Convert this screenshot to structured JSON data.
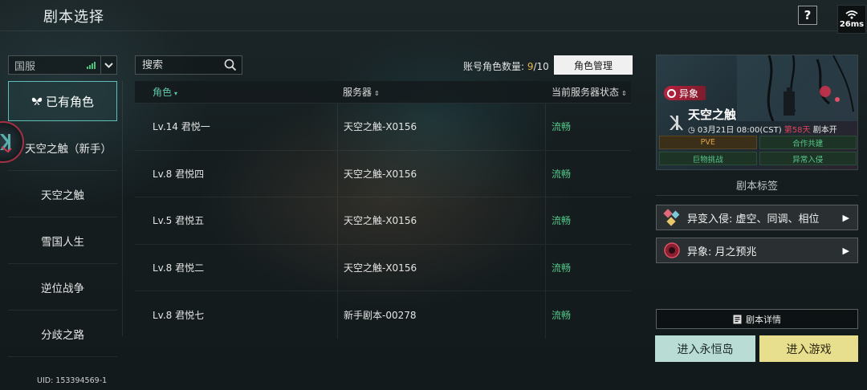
{
  "header": {
    "title": "剧本选择",
    "help_label": "?",
    "ping": "26ms"
  },
  "region": {
    "selected": "国服"
  },
  "sidebar": {
    "items": [
      {
        "label": "已有角色",
        "active": true
      },
      {
        "label": "天空之触（新手）"
      },
      {
        "label": "天空之触"
      },
      {
        "label": "雪国人生"
      },
      {
        "label": "逆位战争"
      },
      {
        "label": "分歧之路"
      }
    ]
  },
  "search": {
    "placeholder": "搜索"
  },
  "account": {
    "label": "账号角色数量: ",
    "current": "9",
    "max": "/10",
    "manage_button": "角色管理"
  },
  "table": {
    "headers": {
      "role": "角色",
      "server": "服务器",
      "status": "当前服务器状态"
    },
    "rows": [
      {
        "role": "Lv.14 君悦一",
        "server": "天空之触-X0156",
        "status": "流畅"
      },
      {
        "role": "Lv.8 君悦四",
        "server": "天空之触-X0156",
        "status": "流畅"
      },
      {
        "role": "Lv.5 君悦五",
        "server": "天空之触-X0156",
        "status": "流畅"
      },
      {
        "role": "Lv.8 君悦二",
        "server": "天空之触-X0156",
        "status": "流畅"
      },
      {
        "role": "Lv.8 君悦七",
        "server": "新手剧本-00278",
        "status": "流畅"
      }
    ]
  },
  "banner": {
    "tag": "异象",
    "title": "天空之触",
    "time": "03月21日 08:00(CST)",
    "days": "第58天",
    "suffix": "剧本开",
    "tags": [
      "PVE",
      "合作共建",
      "巨物挑战",
      "异常入侵"
    ]
  },
  "script_tags": {
    "title": "剧本标签",
    "items": [
      "异变入侵: 虚空、同调、相位",
      "异象: 月之预兆"
    ]
  },
  "actions": {
    "details": "剧本详情",
    "eternal_island": "进入永恒岛",
    "enter_game": "进入游戏"
  },
  "footer": {
    "uid": "UID: 153394569-1"
  },
  "colors": {
    "accent_teal": "#5fbcb8",
    "status_green": "#55c98b",
    "count_highlight": "#e6b84a",
    "anomaly_red": "#b8233e"
  }
}
